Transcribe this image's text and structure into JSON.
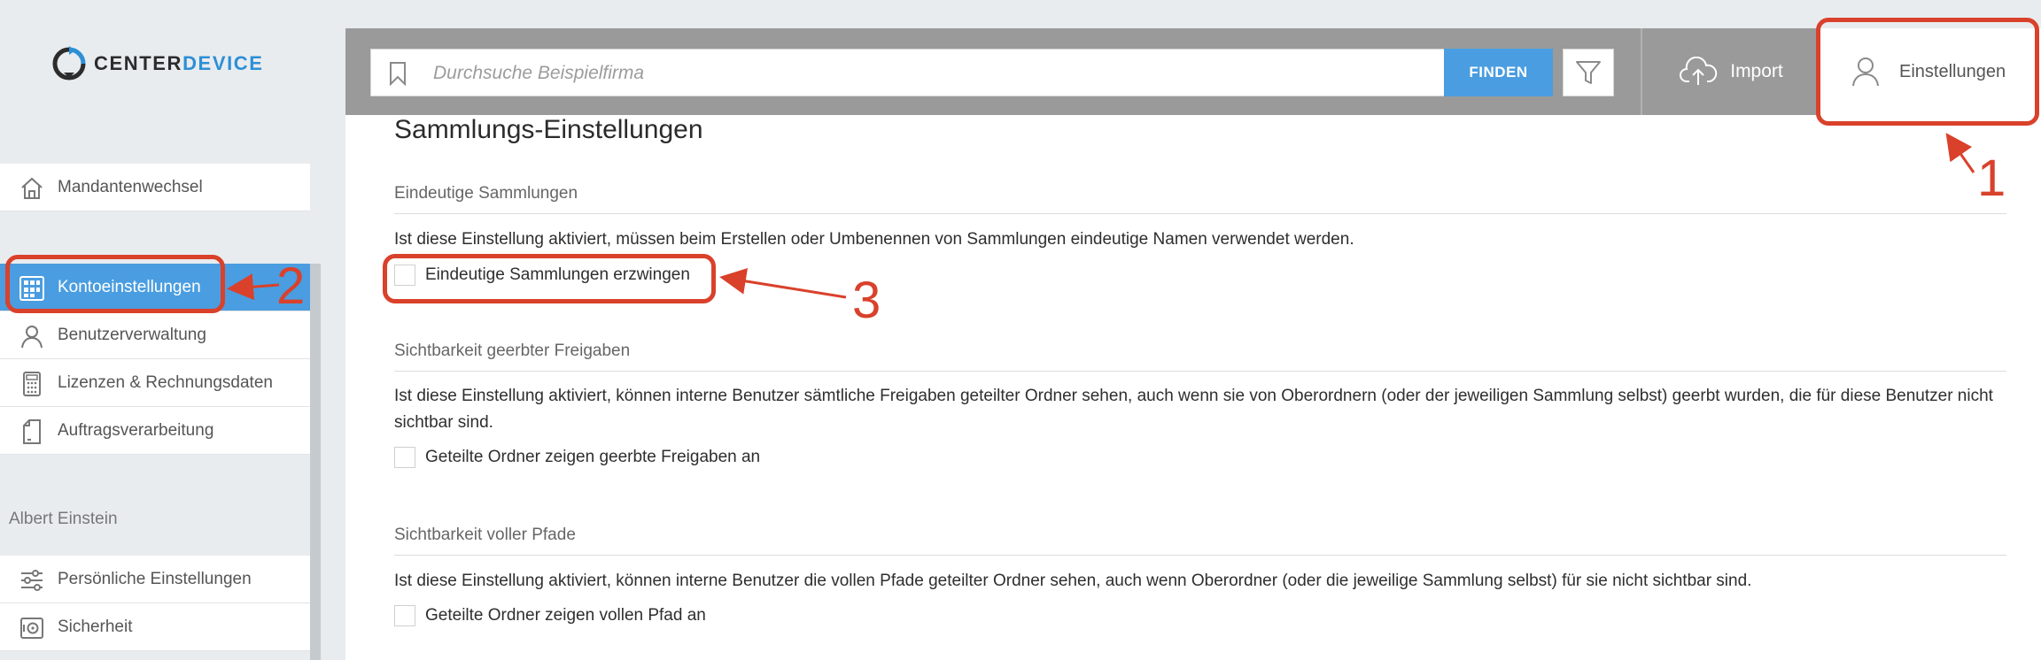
{
  "brand": {
    "name_part1": "CENTER",
    "name_part2": "DEVICE"
  },
  "sidebar": {
    "top_item": {
      "label": "Mandantenwechsel",
      "icon": "home-icon"
    },
    "account_items": [
      {
        "label": "Kontoeinstellungen",
        "icon": "grid-icon",
        "active": true
      },
      {
        "label": "Benutzerverwaltung",
        "icon": "user-icon"
      },
      {
        "label": "Lizenzen & Rechnungsdaten",
        "icon": "calculator-icon"
      },
      {
        "label": "Auftragsverarbeitung",
        "icon": "document-icon"
      }
    ],
    "user_section_title": "Albert Einstein",
    "user_items": [
      {
        "label": "Persönliche Einstellungen",
        "icon": "sliders-icon"
      },
      {
        "label": "Sicherheit",
        "icon": "safe-icon"
      }
    ]
  },
  "header": {
    "search_placeholder": "Durchsuche Beispielfirma",
    "search_value": "",
    "find_label": "FINDEN",
    "import_label": "Import",
    "settings_label": "Einstellungen"
  },
  "main": {
    "title": "Sammlungs-Einstellungen",
    "sections": [
      {
        "heading": "Eindeutige Sammlungen",
        "description": "Ist diese Einstellung aktiviert, müssen beim Erstellen oder Umbenennen von Sammlungen eindeutige Namen verwendet werden.",
        "checkbox_label": "Eindeutige Sammlungen erzwingen",
        "checked": false
      },
      {
        "heading": "Sichtbarkeit geerbter Freigaben",
        "description": "Ist diese Einstellung aktiviert, können interne Benutzer sämtliche Freigaben geteilter Ordner sehen, auch wenn sie von Oberordnern (oder der jeweiligen Sammlung selbst) geerbt wurden, die für diese Benutzer nicht sichtbar sind.",
        "checkbox_label": "Geteilte Ordner zeigen geerbte Freigaben an",
        "checked": false
      },
      {
        "heading": "Sichtbarkeit voller Pfade",
        "description": "Ist diese Einstellung aktiviert, können interne Benutzer die vollen Pfade geteilter Ordner sehen, auch wenn Oberordner (oder die jeweilige Sammlung selbst) für sie nicht sichtbar sind.",
        "checkbox_label": "Geteilte Ordner zeigen vollen Pfad an",
        "checked": false
      }
    ]
  },
  "annotations": {
    "n1": "1",
    "n2": "2",
    "n3": "3"
  },
  "colors": {
    "accent": "#4a9de0",
    "annotation": "#d9412b",
    "topbar": "#9a9a9a"
  }
}
